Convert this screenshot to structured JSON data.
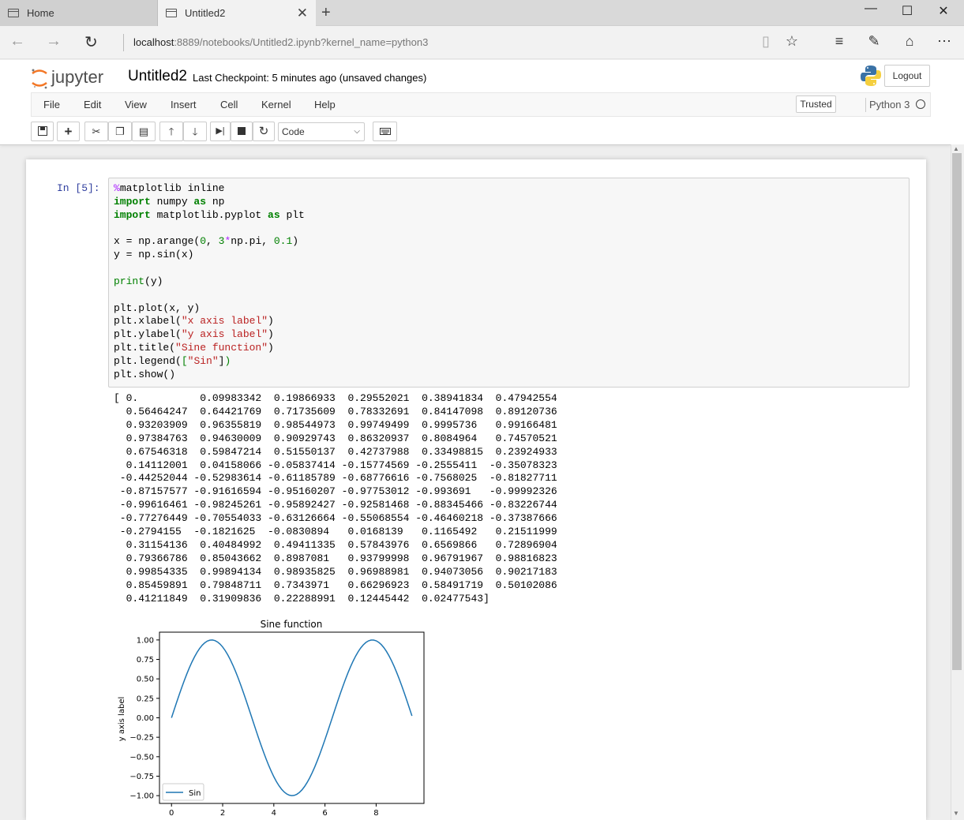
{
  "browser": {
    "tabs": [
      {
        "label": "Home"
      },
      {
        "label": "Untitled2"
      }
    ],
    "new_tab": "+",
    "close_tab": "✕",
    "url_host": "localhost",
    "url_rest": ":8889/notebooks/Untitled2.ipynb?kernel_name=python3",
    "window": {
      "minimize": "—",
      "maximize": "☐",
      "close": "✕"
    }
  },
  "jupyter": {
    "logo_text": "jupyter",
    "notebook_name": "Untitled2",
    "checkpoint": "Last Checkpoint: 5 minutes ago (unsaved changes)",
    "logout": "Logout",
    "menu": [
      "File",
      "Edit",
      "View",
      "Insert",
      "Cell",
      "Kernel",
      "Help"
    ],
    "trusted": "Trusted",
    "kernel": "Python 3",
    "cell_type": "Code"
  },
  "cell": {
    "prompt": "In [5]:",
    "output_lines": [
      "[ 0.          0.09983342  0.19866933  0.29552021  0.38941834  0.47942554",
      "  0.56464247  0.64421769  0.71735609  0.78332691  0.84147098  0.89120736",
      "  0.93203909  0.96355819  0.98544973  0.99749499  0.9995736   0.99166481",
      "  0.97384763  0.94630009  0.90929743  0.86320937  0.8084964   0.74570521",
      "  0.67546318  0.59847214  0.51550137  0.42737988  0.33498815  0.23924933",
      "  0.14112001  0.04158066 -0.05837414 -0.15774569 -0.2555411  -0.35078323",
      " -0.44252044 -0.52983614 -0.61185789 -0.68776616 -0.7568025  -0.81827711",
      " -0.87157577 -0.91616594 -0.95160207 -0.97753012 -0.993691   -0.99992326",
      " -0.99616461 -0.98245261 -0.95892427 -0.92581468 -0.88345466 -0.83226744",
      " -0.77276449 -0.70554033 -0.63126664 -0.55068554 -0.46460218 -0.37387666",
      " -0.2794155  -0.1821625  -0.0830894   0.0168139   0.1165492   0.21511999",
      "  0.31154136  0.40484992  0.49411335  0.57843976  0.6569866   0.72896904",
      "  0.79366786  0.85043662  0.8987081   0.93799998  0.96791967  0.98816823",
      "  0.99854335  0.99894134  0.98935825  0.96988981  0.94073056  0.90217183",
      "  0.85459891  0.79848711  0.7343971   0.66296923  0.58491719  0.50102086",
      "  0.41211849  0.31909836  0.22288991  0.12445442  0.02477543]"
    ]
  },
  "chart_data": {
    "type": "line",
    "title": "Sine function",
    "xlabel": "x axis label",
    "ylabel": "y axis label",
    "x_start": 0.0,
    "x_step": 0.1,
    "series": [
      {
        "name": "Sin",
        "color": "#1f77b4",
        "values": [
          0.0,
          0.09983342,
          0.19866933,
          0.29552021,
          0.38941834,
          0.47942554,
          0.56464247,
          0.64421769,
          0.71735609,
          0.78332691,
          0.84147098,
          0.89120736,
          0.93203909,
          0.96355819,
          0.98544973,
          0.99749499,
          0.9995736,
          0.99166481,
          0.97384763,
          0.94630009,
          0.90929743,
          0.86320937,
          0.8084964,
          0.74570521,
          0.67546318,
          0.59847214,
          0.51550137,
          0.42737988,
          0.33498815,
          0.23924933,
          0.14112001,
          0.04158066,
          -0.05837414,
          -0.15774569,
          -0.2555411,
          -0.35078323,
          -0.44252044,
          -0.52983614,
          -0.61185789,
          -0.68776616,
          -0.7568025,
          -0.81827711,
          -0.87157577,
          -0.91616594,
          -0.95160207,
          -0.97753012,
          -0.993691,
          -0.99992326,
          -0.99616461,
          -0.98245261,
          -0.95892427,
          -0.92581468,
          -0.88345466,
          -0.83226744,
          -0.77276449,
          -0.70554033,
          -0.63126664,
          -0.55068554,
          -0.46460218,
          -0.37387666,
          -0.2794155,
          -0.1821625,
          -0.0830894,
          0.0168139,
          0.1165492,
          0.21511999,
          0.31154136,
          0.40484992,
          0.49411335,
          0.57843976,
          0.6569866,
          0.72896904,
          0.79366786,
          0.85043662,
          0.8987081,
          0.93799998,
          0.96791967,
          0.98816823,
          0.99854335,
          0.99894134,
          0.98935825,
          0.96988981,
          0.94073056,
          0.90217183,
          0.85459891,
          0.79848711,
          0.7343971,
          0.66296923,
          0.58491719,
          0.50102086,
          0.41211849,
          0.31909836,
          0.22288991,
          0.12445442,
          0.02477543
        ]
      }
    ],
    "xlim": [
      -0.47,
      9.87
    ],
    "ylim": [
      -1.1,
      1.1
    ],
    "xticks": [
      0,
      2,
      4,
      6,
      8
    ],
    "xtick_labels": [
      "0",
      "2",
      "4",
      "6",
      "8"
    ],
    "yticks": [
      1.0,
      0.75,
      0.5,
      0.25,
      0.0,
      -0.25,
      -0.5,
      -0.75,
      -1.0
    ],
    "ytick_labels": [
      "1.00",
      "0.75",
      "0.50",
      "0.25",
      "0.00",
      "−0.25",
      "−0.50",
      "−0.75",
      "−1.00"
    ],
    "legend_position": "lower-left",
    "grid": false
  }
}
